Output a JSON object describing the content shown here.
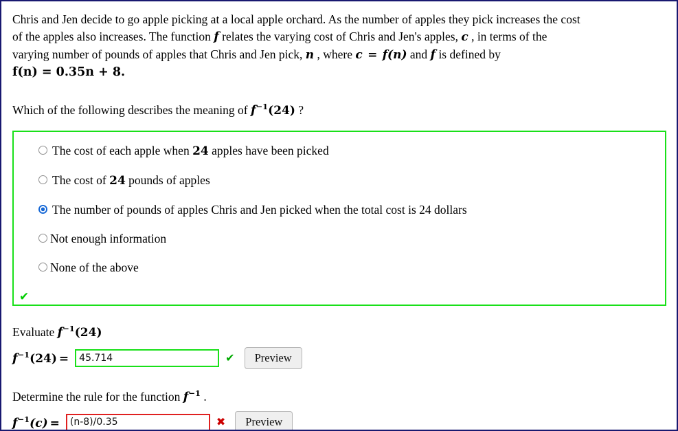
{
  "problem": {
    "line1": "Chris and Jen decide to go apple picking at a local apple orchard. As the number of apples they pick increases the cost",
    "line2_a": "of the apples also increases. The function",
    "line2_f": "f",
    "line2_b": "relates the varying cost of Chris and Jen's apples,",
    "line2_c": "c",
    "line2_d": ", in terms of the",
    "line3_a": "varying number of pounds of apples that Chris and Jen pick,",
    "line3_n": "n",
    "line3_b": ", where",
    "line3_c": "c",
    "line3_eq": "=",
    "line3_fn": "f(n)",
    "line3_and": "and",
    "line3_f": "f",
    "line3_end": "is defined by",
    "line4_formula": "f(n) = 0.35n + 8."
  },
  "question": {
    "prefix": "Which of the following describes the meaning of",
    "math_f": "f",
    "math_sup": "−1",
    "math_arg": "(24)",
    "suffix": "?"
  },
  "choices": {
    "items": [
      {
        "label_a": "The cost of each apple when",
        "label_num": "24",
        "label_b": "apples have been picked",
        "selected": false,
        "tight": false
      },
      {
        "label_a": "The cost of",
        "label_num": "24",
        "label_b": "pounds of apples",
        "selected": false,
        "tight": false
      },
      {
        "label_a": "The number of pounds of apples Chris and Jen picked when the total cost is 24 dollars",
        "label_num": "",
        "label_b": "",
        "selected": true,
        "tight": false
      },
      {
        "label_a": "Not enough information",
        "label_num": "",
        "label_b": "",
        "selected": false,
        "tight": true
      },
      {
        "label_a": "None of the above",
        "label_num": "",
        "label_b": "",
        "selected": false,
        "tight": true
      }
    ],
    "status_icon": "✔",
    "status_color": "#00cc00",
    "border_color": "#19e019"
  },
  "evaluate": {
    "heading_prefix": "Evaluate",
    "math_f": "f",
    "math_sup": "−1",
    "math_arg": "(24)",
    "lhs_f": "f",
    "lhs_sup": "−1",
    "lhs_arg": "(24)",
    "lhs_eq": "=",
    "input_value": "45.714",
    "input_placeholder": "",
    "status_icon": "✔",
    "status_color": "#00aa00",
    "border_color": "#19e019",
    "preview_label": "Preview"
  },
  "determine": {
    "heading_prefix": "Determine the rule for the function",
    "math_f": "f",
    "math_sup": "−1",
    "heading_suffix": ".",
    "lhs_f": "f",
    "lhs_sup": "−1",
    "lhs_arg": "(c)",
    "lhs_eq": "=",
    "input_value": "(n-8)/0.35",
    "input_placeholder": "",
    "status_icon": "✖",
    "status_color": "#cc0000",
    "border_color": "#e02020",
    "preview_label": "Preview"
  },
  "theme": {
    "page_border": "#191970",
    "background": "#ffffff"
  }
}
